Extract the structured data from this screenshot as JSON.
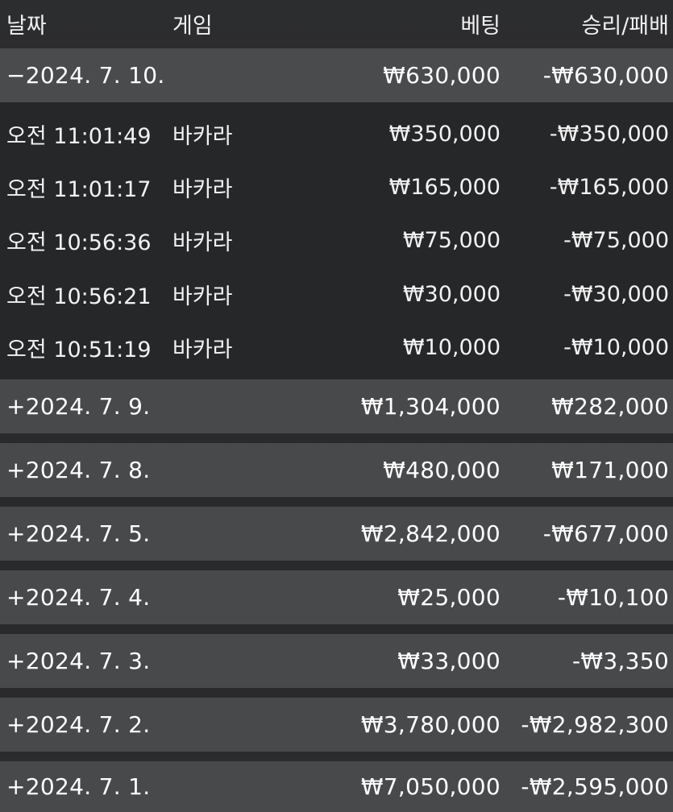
{
  "header": {
    "date": "날짜",
    "game": "게임",
    "bet": "베팅",
    "winloss": "승리/패배"
  },
  "expanded_group": {
    "date": "−2024. 7. 10.",
    "bet": "₩630,000",
    "winloss": "-₩630,000",
    "details": [
      {
        "time": "오전 11:01:49",
        "game": "바카라",
        "bet": "₩350,000",
        "winloss": "-₩350,000"
      },
      {
        "time": "오전 11:01:17",
        "game": "바카라",
        "bet": "₩165,000",
        "winloss": "-₩165,000"
      },
      {
        "time": "오전 10:56:36",
        "game": "바카라",
        "bet": "₩75,000",
        "winloss": "-₩75,000"
      },
      {
        "time": "오전 10:56:21",
        "game": "바카라",
        "bet": "₩30,000",
        "winloss": "-₩30,000"
      },
      {
        "time": "오전 10:51:19",
        "game": "바카라",
        "bet": "₩10,000",
        "winloss": "-₩10,000"
      }
    ]
  },
  "groups": [
    {
      "date": "+2024. 7. 9.",
      "bet": "₩1,304,000",
      "winloss": "₩282,000"
    },
    {
      "date": "+2024. 7. 8.",
      "bet": "₩480,000",
      "winloss": "₩171,000"
    },
    {
      "date": "+2024. 7. 5.",
      "bet": "₩2,842,000",
      "winloss": "-₩677,000"
    },
    {
      "date": "+2024. 7. 4.",
      "bet": "₩25,000",
      "winloss": "-₩10,100"
    },
    {
      "date": "+2024. 7. 3.",
      "bet": "₩33,000",
      "winloss": "-₩3,350"
    },
    {
      "date": "+2024. 7. 2.",
      "bet": "₩3,780,000",
      "winloss": "-₩2,982,300"
    },
    {
      "date": "+2024. 7. 1.",
      "bet": "₩7,050,000",
      "winloss": "-₩2,595,000"
    }
  ]
}
